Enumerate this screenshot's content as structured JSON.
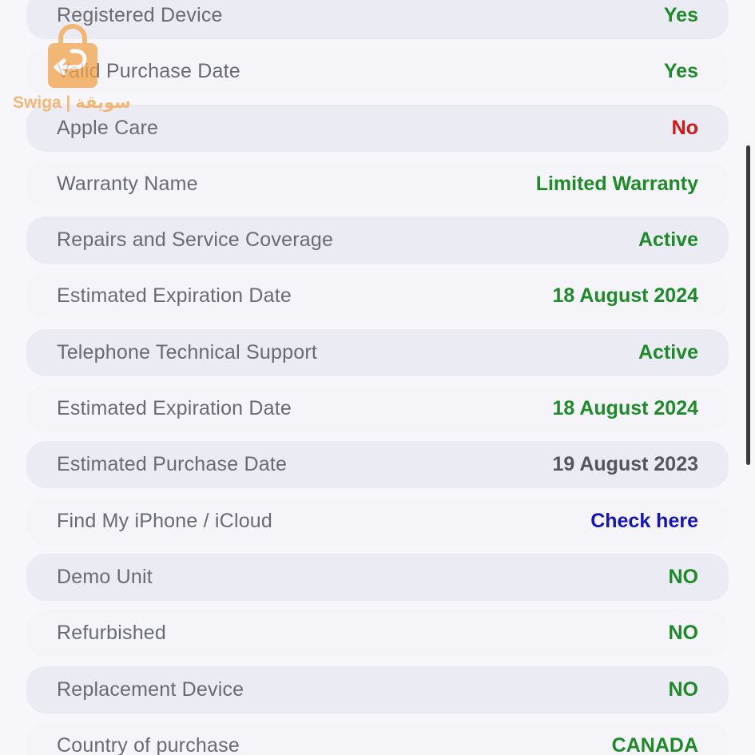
{
  "rows": [
    {
      "label": "Registered Device",
      "value": "Yes",
      "color": "#1f8a2a"
    },
    {
      "label": "Valid Purchase Date",
      "value": "Yes",
      "color": "#1f8a2a"
    },
    {
      "label": "Apple Care",
      "value": "No",
      "color": "#d01818"
    },
    {
      "label": "Warranty Name",
      "value": "Limited Warranty",
      "color": "#1f8a2a"
    },
    {
      "label": "Repairs and Service Coverage",
      "value": "Active",
      "color": "#1f8a2a"
    },
    {
      "label": "Estimated Expiration Date",
      "value": "18 August 2024",
      "color": "#1f8a2a"
    },
    {
      "label": "Telephone Technical Support",
      "value": "Active",
      "color": "#1f8a2a"
    },
    {
      "label": "Estimated Expiration Date",
      "value": "18 August 2024",
      "color": "#1f8a2a"
    },
    {
      "label": "Estimated Purchase Date",
      "value": "19 August 2023",
      "color": "#555560"
    },
    {
      "label": "Find My iPhone / iCloud",
      "value": "Check here",
      "color": "#1515b8"
    },
    {
      "label": "Demo Unit",
      "value": "NO",
      "color": "#1f8a2a"
    },
    {
      "label": "Refurbished",
      "value": "NO",
      "color": "#1f8a2a"
    },
    {
      "label": "Replacement Device",
      "value": "NO",
      "color": "#1f8a2a"
    },
    {
      "label": "Country of purchase",
      "value": "CANADA",
      "color": "#1f8a2a"
    }
  ],
  "watermark": {
    "text": "Swiga | سويقة",
    "icon": "shopping-bag-icon",
    "color": "#f3a34a"
  }
}
